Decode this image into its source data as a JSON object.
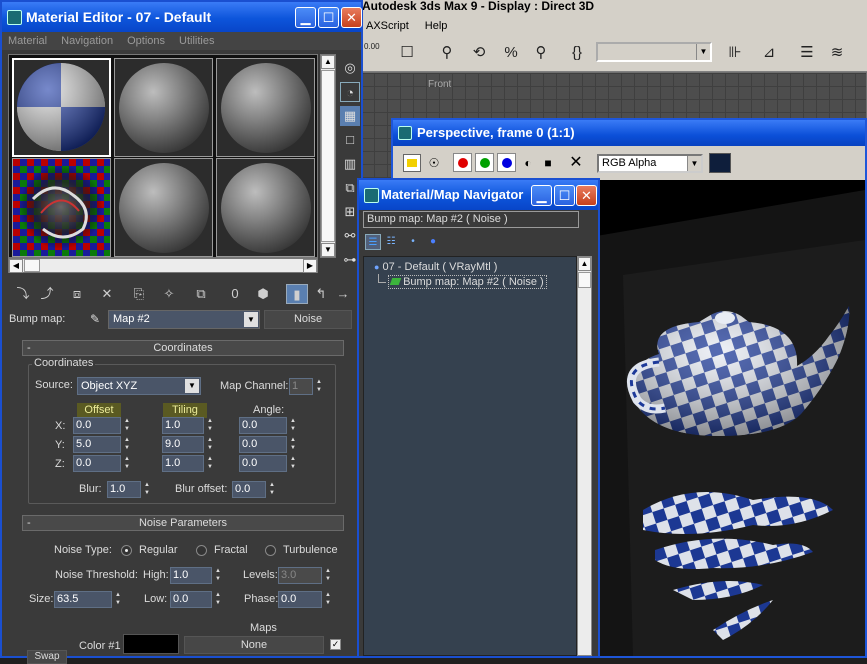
{
  "max_app": {
    "title": "Autodesk 3ds Max 9       - Display : Direct 3D",
    "menu": [
      "AXScript",
      "Help"
    ],
    "toolbar_small_label": "0.00",
    "front_viewport_label": "Front"
  },
  "perspective": {
    "title": "Perspective, frame 0 (1:1)",
    "channel": "RGB Alpha"
  },
  "material_editor": {
    "title": "Material Editor - 07 - Default",
    "menu": [
      "Material",
      "Navigation",
      "Options",
      "Utilities"
    ],
    "bump_label": "Bump map:",
    "map_name": "Map #2",
    "map_type": "Noise",
    "coordinates": {
      "rollout_title": "Coordinates",
      "group_title": "Coordinates",
      "source_label": "Source:",
      "source_value": "Object XYZ",
      "map_channel_label": "Map Channel:",
      "map_channel_value": "1",
      "offset_label": "Offset",
      "tiling_label": "Tiling",
      "angle_label": "Angle:",
      "axis_x": "X:",
      "axis_y": "Y:",
      "axis_z": "Z:",
      "offset": {
        "x": "0.0",
        "y": "5.0",
        "z": "0.0"
      },
      "tiling": {
        "x": "1.0",
        "y": "9.0",
        "z": "1.0"
      },
      "angle": {
        "x": "0.0",
        "y": "0.0",
        "z": "0.0"
      },
      "blur_label": "Blur:",
      "blur_value": "1.0",
      "blur_offset_label": "Blur offset:",
      "blur_offset_value": "0.0"
    },
    "noise": {
      "rollout_title": "Noise Parameters",
      "type_label": "Noise Type:",
      "types": [
        "Regular",
        "Fractal",
        "Turbulence"
      ],
      "selected_type": "Regular",
      "threshold_label": "Noise Threshold:",
      "high_label": "High:",
      "high_value": "1.0",
      "levels_label": "Levels:",
      "levels_value": "3.0",
      "size_label": "Size:",
      "size_value": "63.5",
      "low_label": "Low:",
      "low_value": "0.0",
      "phase_label": "Phase:",
      "phase_value": "0.0",
      "maps_label": "Maps",
      "color1_label": "Color #1",
      "color1_map": "None",
      "swap_label": "Swap"
    },
    "collapse_glyph": "-"
  },
  "navigator": {
    "title": "Material/Map Navigator",
    "path": "Bump map: Map #2 ( Noise )",
    "tree": [
      {
        "label": "07 - Default  ( VRayMtl )"
      },
      {
        "label": "Bump map: Map #2  ( Noise )"
      }
    ]
  },
  "colors": {
    "titlebar_blue": "#0d55db",
    "field_bg": "#4a5568",
    "panel_bg": "#3a3a3a"
  }
}
